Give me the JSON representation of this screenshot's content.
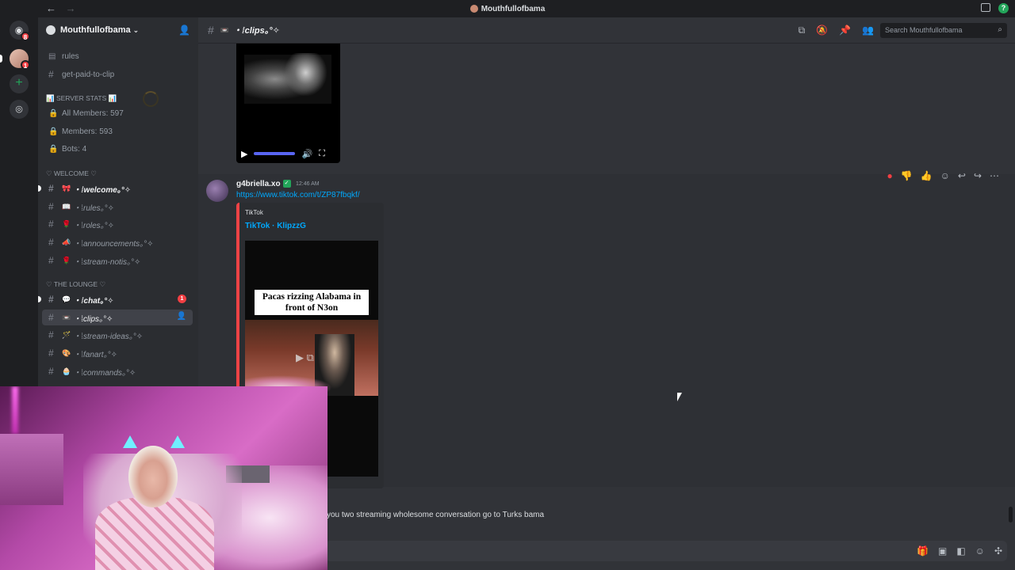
{
  "titlebar": {
    "title": "Mouthfullofbama",
    "back": "←",
    "forward": "→",
    "help": "?"
  },
  "guilds": {
    "home_badge": "8",
    "server_badge": "1",
    "add_label": "+"
  },
  "server": {
    "name": "Mouthfullofbama",
    "chevron": "⌄"
  },
  "channels": {
    "top": [
      {
        "name": "rules",
        "type": "rules"
      },
      {
        "name": "get-paid-to-clip",
        "type": "text"
      }
    ],
    "stats_category": "📊 SERVER STATS 📊",
    "stats": [
      {
        "name": "All Members: 597"
      },
      {
        "name": "Members: 593"
      },
      {
        "name": "Bots: 4"
      }
    ],
    "welcome_category": "♡ WELCOME ♡",
    "welcome": [
      {
        "emoji": "🎀",
        "name": "・⁞welcome｡°✧",
        "unread": true
      },
      {
        "emoji": "📖",
        "name": "・⁞rules｡°✧"
      },
      {
        "emoji": "🌹",
        "name": "・⁞roles｡°✧"
      },
      {
        "emoji": "📣",
        "name": "・⁞announcements｡°✧"
      },
      {
        "emoji": "🌹",
        "name": "・⁞stream-notis｡°✧"
      }
    ],
    "lounge_category": "♡ THE LOUNGE ♡",
    "lounge": [
      {
        "emoji": "💬",
        "name": "・⁞chat｡°✧",
        "unread": true,
        "mentions": "1"
      },
      {
        "emoji": "📼",
        "name": "・⁞clips｡°✧",
        "selected": true
      },
      {
        "emoji": "🪄",
        "name": "・⁞stream-ideas｡°✧"
      },
      {
        "emoji": "🎨",
        "name": "・⁞fanart｡°✧"
      },
      {
        "emoji": "🧁",
        "name": "・⁞commands｡°✧"
      }
    ]
  },
  "header": {
    "channel_emoji": "📼",
    "channel_name": "・⁞clips｡°✧",
    "search_placeholder": "Search Mouthfullofbama"
  },
  "message": {
    "author": "g4briella.xo",
    "timestamp": "12:46 AM",
    "link": "https://www.tiktok.com/t/ZP87fbqkf/",
    "embed_provider": "TikTok",
    "embed_title": "TikTok · KlipzzG",
    "video_caption": "Pacas rizzing Alabama in front of N3on"
  },
  "next_message": {
    "text": "you two streaming wholesome conversation go to Turks bama"
  },
  "colors": {
    "accent": "#5865f2",
    "embed_border": "#ed4245",
    "link": "#00a8fc",
    "online": "#23a55a"
  }
}
